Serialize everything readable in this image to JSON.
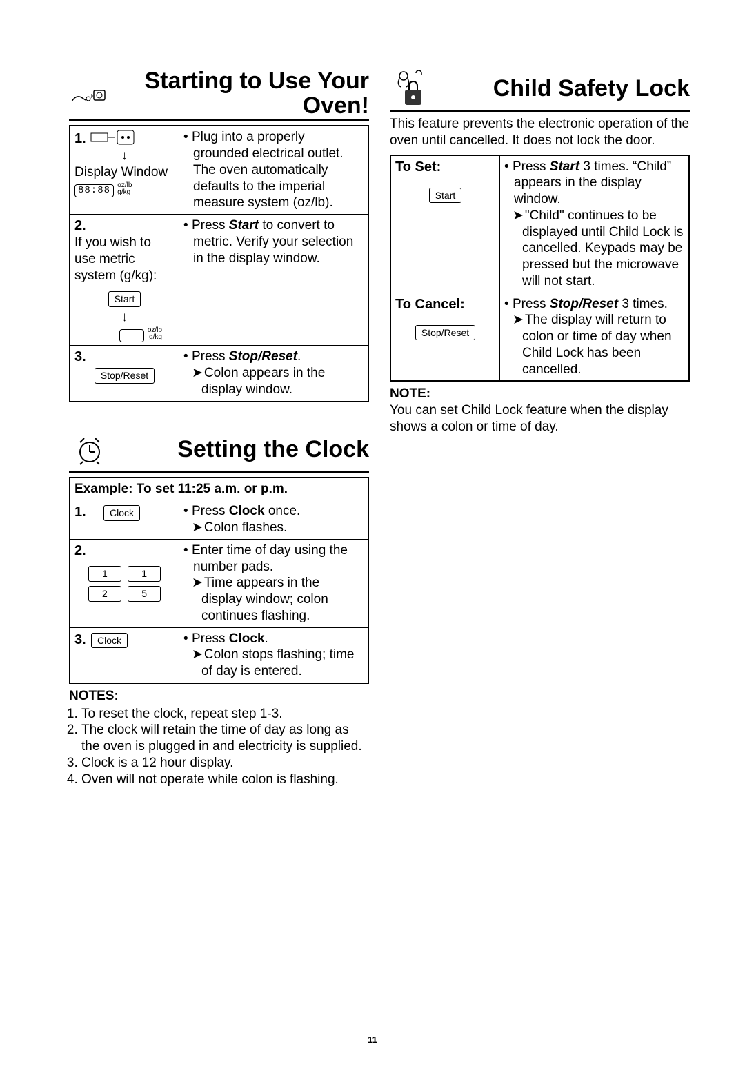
{
  "page_number": "11",
  "starting": {
    "title": "Starting to Use Your Oven!",
    "step1": {
      "num": "1.",
      "display_label": "Display Window",
      "display_value": "88:88",
      "unit_oz": "oz/lb",
      "unit_g": "g/kg",
      "b1": "Plug into a properly grounded electrical outlet.",
      "b2": "The oven automatically defaults to the imperial measure system (oz/lb)."
    },
    "step2": {
      "num": "2.",
      "left": "If you wish to use metric system (g/kg):",
      "btn": "Start",
      "unit_oz": "oz/lb",
      "unit_g": "g/kg",
      "r_pre": "Press ",
      "r_bold": "Start",
      "r_post": " to convert to metric. Verify your selection in the display window."
    },
    "step3": {
      "num": "3.",
      "btn": "Stop/Reset",
      "r_pre": "Press ",
      "r_bold": "Stop/Reset",
      "r_post": ".",
      "arrow": "Colon appears in the display window."
    }
  },
  "clock": {
    "title": "Setting the Clock",
    "example": "Example: To set 11:25 a.m. or p.m.",
    "step1": {
      "num": "1.",
      "btn": "Clock",
      "r_pre": "Press ",
      "r_bold": "Clock",
      "r_post": " once.",
      "arrow": "Colon flashes."
    },
    "step2": {
      "num": "2.",
      "p1": "1",
      "p2": "1",
      "p3": "2",
      "p4": "5",
      "r1": "Enter time of day using the number pads.",
      "arrow": "Time appears in the display window; colon continues flashing."
    },
    "step3": {
      "num": "3.",
      "btn": "Clock",
      "r_pre": "Press ",
      "r_bold": "Clock",
      "r_post": ".",
      "arrow": "Colon stops flashing; time of day is entered."
    },
    "notes_head": "NOTES:",
    "n1": "To reset the clock, repeat step 1-3.",
    "n2": "The clock will retain the time of day as long as the oven is plugged in and electricity is supplied.",
    "n3": "Clock is a 12 hour display.",
    "n4": "Oven will not operate while colon is flashing."
  },
  "child": {
    "title": "Child Safety Lock",
    "intro": "This feature prevents the electronic operation of the oven until cancelled. It does not lock the door.",
    "set": {
      "label": "To Set:",
      "btn": "Start",
      "r_pre": "Press ",
      "r_bold": "Start",
      "r_post": " 3 times. “Child” appears in the display window.",
      "arrow": "\"Child\" continues to be displayed until Child Lock is cancelled. Keypads may be pressed but the microwave will not start."
    },
    "cancel": {
      "label": "To Cancel:",
      "btn": "Stop/Reset",
      "r_pre": "Press ",
      "r_bold": "Stop/Reset",
      "r_post": " 3 times.",
      "arrow": "The display will return to colon or time of day when Child Lock has been cancelled."
    },
    "note_head": "NOTE:",
    "note": "You can set Child Lock feature when the display shows a colon or time of day."
  }
}
